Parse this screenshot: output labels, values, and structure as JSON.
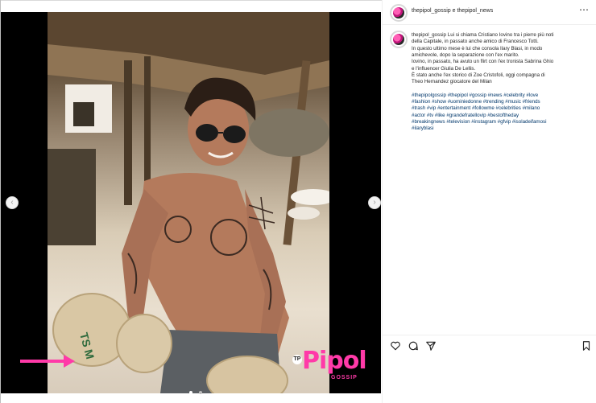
{
  "post": {
    "header": {
      "author": "thepipol_gossip",
      "connector": "e",
      "collaborator": "thepipol_news",
      "more_icon": "⋯"
    },
    "caption": {
      "username": "thepipol_gossip",
      "lines": [
        "Lui si chiama Cristiano Iovino tra i pierre più noti",
        "della Capitale, in passato anche amico di Francesco Totti.",
        "In questo ultimo mese è lui che consola Ilary Blasi, in modo",
        "amichevole, dopo la separazione con l'ex marito.",
        "Iovino, in passato, ha avuto un flirt con l'ex tronista Sabrina Ghio",
        "e l'influencer Giulia De Lellis.",
        "È stato anche l'ex storico di Zoe Cristofoli, oggi compagna di",
        "Theo Hernandez giocatore del Milan"
      ],
      "first_line_rest": "Lui si chiama Cristiano Iovino tra i pierre più noti",
      "hashtag_lines": [
        "#thepipolgossip #thepipol #gossip #news #celebrity #love",
        "#fashion #show #uominiedonne #trending #music #friends",
        "#trash #vip #entertainment #followme #celebrities #milano",
        "#actor #tv #like #grandefratellovip #bestoftheday",
        "#breakingnews #television #instagram #gfvip #isoladeifamosi",
        "#ilaryblasi"
      ]
    },
    "image": {
      "watermark_main": "Pipol",
      "watermark_sub": "GOSSIP",
      "watermark_badge": "TP",
      "coconut_text": "TS M"
    },
    "nav": {
      "prev": "‹",
      "next": "›"
    }
  },
  "icons": [
    "heart-icon",
    "comment-icon",
    "share-icon",
    "bookmark-icon",
    "more-icon",
    "chevron-left-icon",
    "chevron-right-icon"
  ],
  "colors": {
    "watermark_pink": "#ff3aa8",
    "hashtag": "#00376b",
    "text": "#262626"
  }
}
